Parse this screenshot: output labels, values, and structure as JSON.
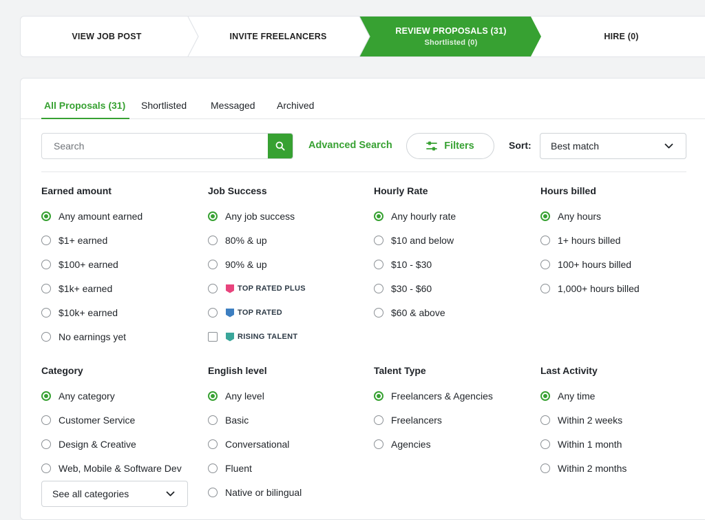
{
  "stepper": {
    "steps": [
      {
        "label": "VIEW JOB POST"
      },
      {
        "label": "INVITE FREELANCERS"
      },
      {
        "label": "REVIEW PROPOSALS (31)",
        "sub": "Shortlisted (0)"
      },
      {
        "label": "HIRE (0)"
      }
    ],
    "active_color": "#37a132"
  },
  "tabs": [
    {
      "label": "All Proposals (31)",
      "active": true
    },
    {
      "label": "Shortlisted"
    },
    {
      "label": "Messaged"
    },
    {
      "label": "Archived"
    }
  ],
  "toolbar": {
    "search_placeholder": "Search",
    "search_icon": "search-icon",
    "advanced_search": "Advanced Search",
    "filters_label": "Filters",
    "filters_icon": "sliders-icon",
    "sort_label": "Sort:",
    "sort_value": "Best match"
  },
  "groups": {
    "earned": {
      "title": "Earned amount",
      "options": [
        "Any amount earned",
        "$1+ earned",
        "$100+ earned",
        "$1k+ earned",
        "$10k+ earned",
        "No earnings yet"
      ],
      "selected": 0
    },
    "job_success": {
      "title": "Job Success",
      "options": [
        "Any job success",
        "80% & up",
        "90% & up"
      ],
      "badges": [
        "TOP RATED PLUS",
        "TOP RATED",
        "RISING TALENT"
      ],
      "badge_colors": [
        "#e8447d",
        "#3d7fc1",
        "#3aa69a"
      ],
      "selected": 0
    },
    "hourly": {
      "title": "Hourly Rate",
      "options": [
        "Any hourly rate",
        "$10 and below",
        "$10 - $30",
        "$30 - $60",
        "$60 & above"
      ],
      "selected": 0
    },
    "hours": {
      "title": "Hours billed",
      "options": [
        "Any hours",
        "1+ hours billed",
        "100+ hours billed",
        "1,000+ hours billed"
      ],
      "selected": 0
    },
    "category": {
      "title": "Category",
      "options": [
        "Any category",
        "Customer Service",
        "Design & Creative",
        "Web, Mobile & Software Dev"
      ],
      "selected": 0,
      "see_all": "See all categories"
    },
    "english": {
      "title": "English level",
      "options": [
        "Any level",
        "Basic",
        "Conversational",
        "Fluent",
        "Native or bilingual"
      ],
      "selected": 0
    },
    "talent": {
      "title": "Talent Type",
      "options": [
        "Freelancers & Agencies",
        "Freelancers",
        "Agencies"
      ],
      "selected": 0
    },
    "activity": {
      "title": "Last Activity",
      "options": [
        "Any time",
        "Within 2 weeks",
        "Within 1 month",
        "Within 2 months"
      ],
      "selected": 0
    }
  }
}
